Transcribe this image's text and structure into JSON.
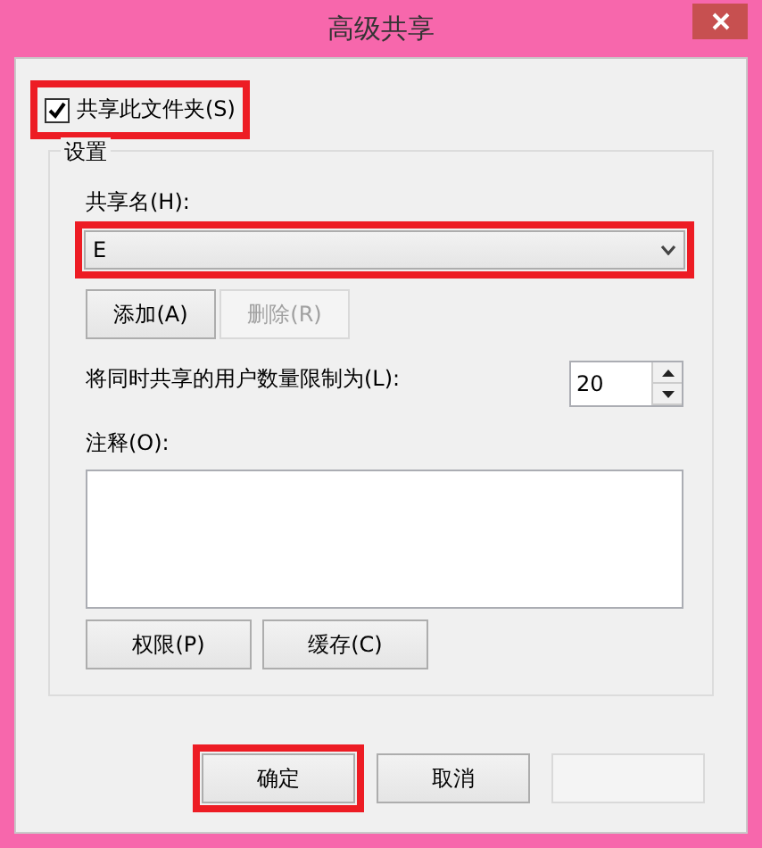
{
  "window": {
    "title": "高级共享"
  },
  "share_checkbox": {
    "label": "共享此文件夹(S)",
    "checked": true,
    "highlighted": true
  },
  "settings": {
    "title": "设置",
    "share_name": {
      "label": "共享名(H):",
      "value": "E",
      "highlighted": true
    },
    "name_buttons": [
      {
        "label": "添加(A)",
        "disabled": false
      },
      {
        "label": "删除(R)",
        "disabled": true
      }
    ],
    "user_limit": {
      "label": "将同时共享的用户数量限制为(L):",
      "value": "20"
    },
    "comment": {
      "label": "注释(O):"
    },
    "buttons": [
      {
        "label": "权限(P)",
        "disabled": false
      },
      {
        "label": "缓存(C)",
        "disabled": false
      }
    ]
  },
  "dialog_buttons": [
    {
      "label": "确定",
      "highlighted": true,
      "disabled": false
    },
    {
      "label": "取消",
      "highlighted": false,
      "disabled": false
    },
    {
      "disabled": true,
      "highlighted": false
    }
  ]
}
